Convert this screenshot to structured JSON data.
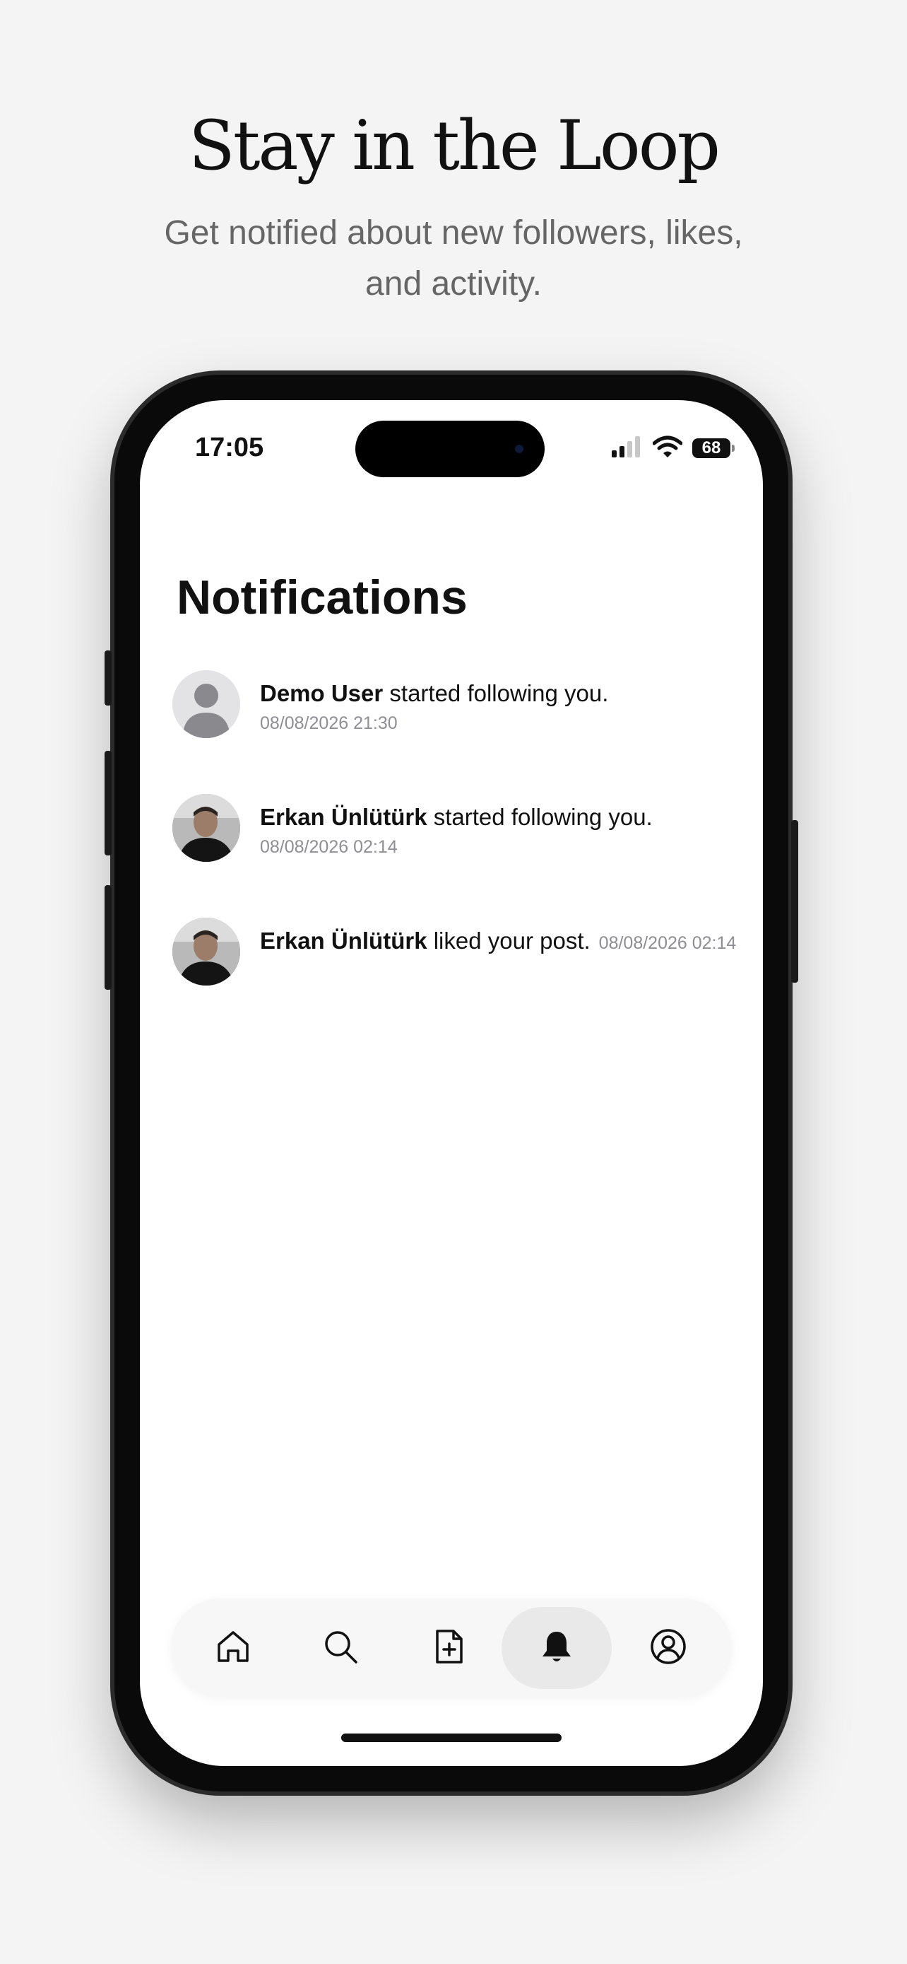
{
  "promo": {
    "title": "Stay in the Loop",
    "subtitle": "Get notified about new followers, likes, and activity."
  },
  "status_bar": {
    "time": "17:05",
    "battery": "68",
    "icons": [
      "signal-icon",
      "wifi-icon",
      "battery-icon"
    ]
  },
  "screen": {
    "title": "Notifications"
  },
  "notifications": [
    {
      "avatar": "default-avatar-icon",
      "name": "Demo User",
      "action": " started following you.",
      "time": "08/08/2026 21:30"
    },
    {
      "avatar": "user-photo",
      "name": "Erkan Ünlütürk",
      "action": " started following you.",
      "time": "08/08/2026 02:14"
    },
    {
      "avatar": "user-photo",
      "name": "Erkan Ünlütürk",
      "action": " liked your post.",
      "time": "08/08/2026 02:14"
    }
  ],
  "tab_bar": {
    "tabs": [
      {
        "icon": "home-icon",
        "active": false
      },
      {
        "icon": "search-icon",
        "active": false
      },
      {
        "icon": "new-post-icon",
        "active": false
      },
      {
        "icon": "bell-icon",
        "active": true
      },
      {
        "icon": "profile-icon",
        "active": false
      }
    ]
  },
  "colors": {
    "background": "#f4f4f4",
    "screen": "#ffffff",
    "text": "#111111",
    "muted": "#8e8e93",
    "active_tab": "#e9e9e9"
  }
}
